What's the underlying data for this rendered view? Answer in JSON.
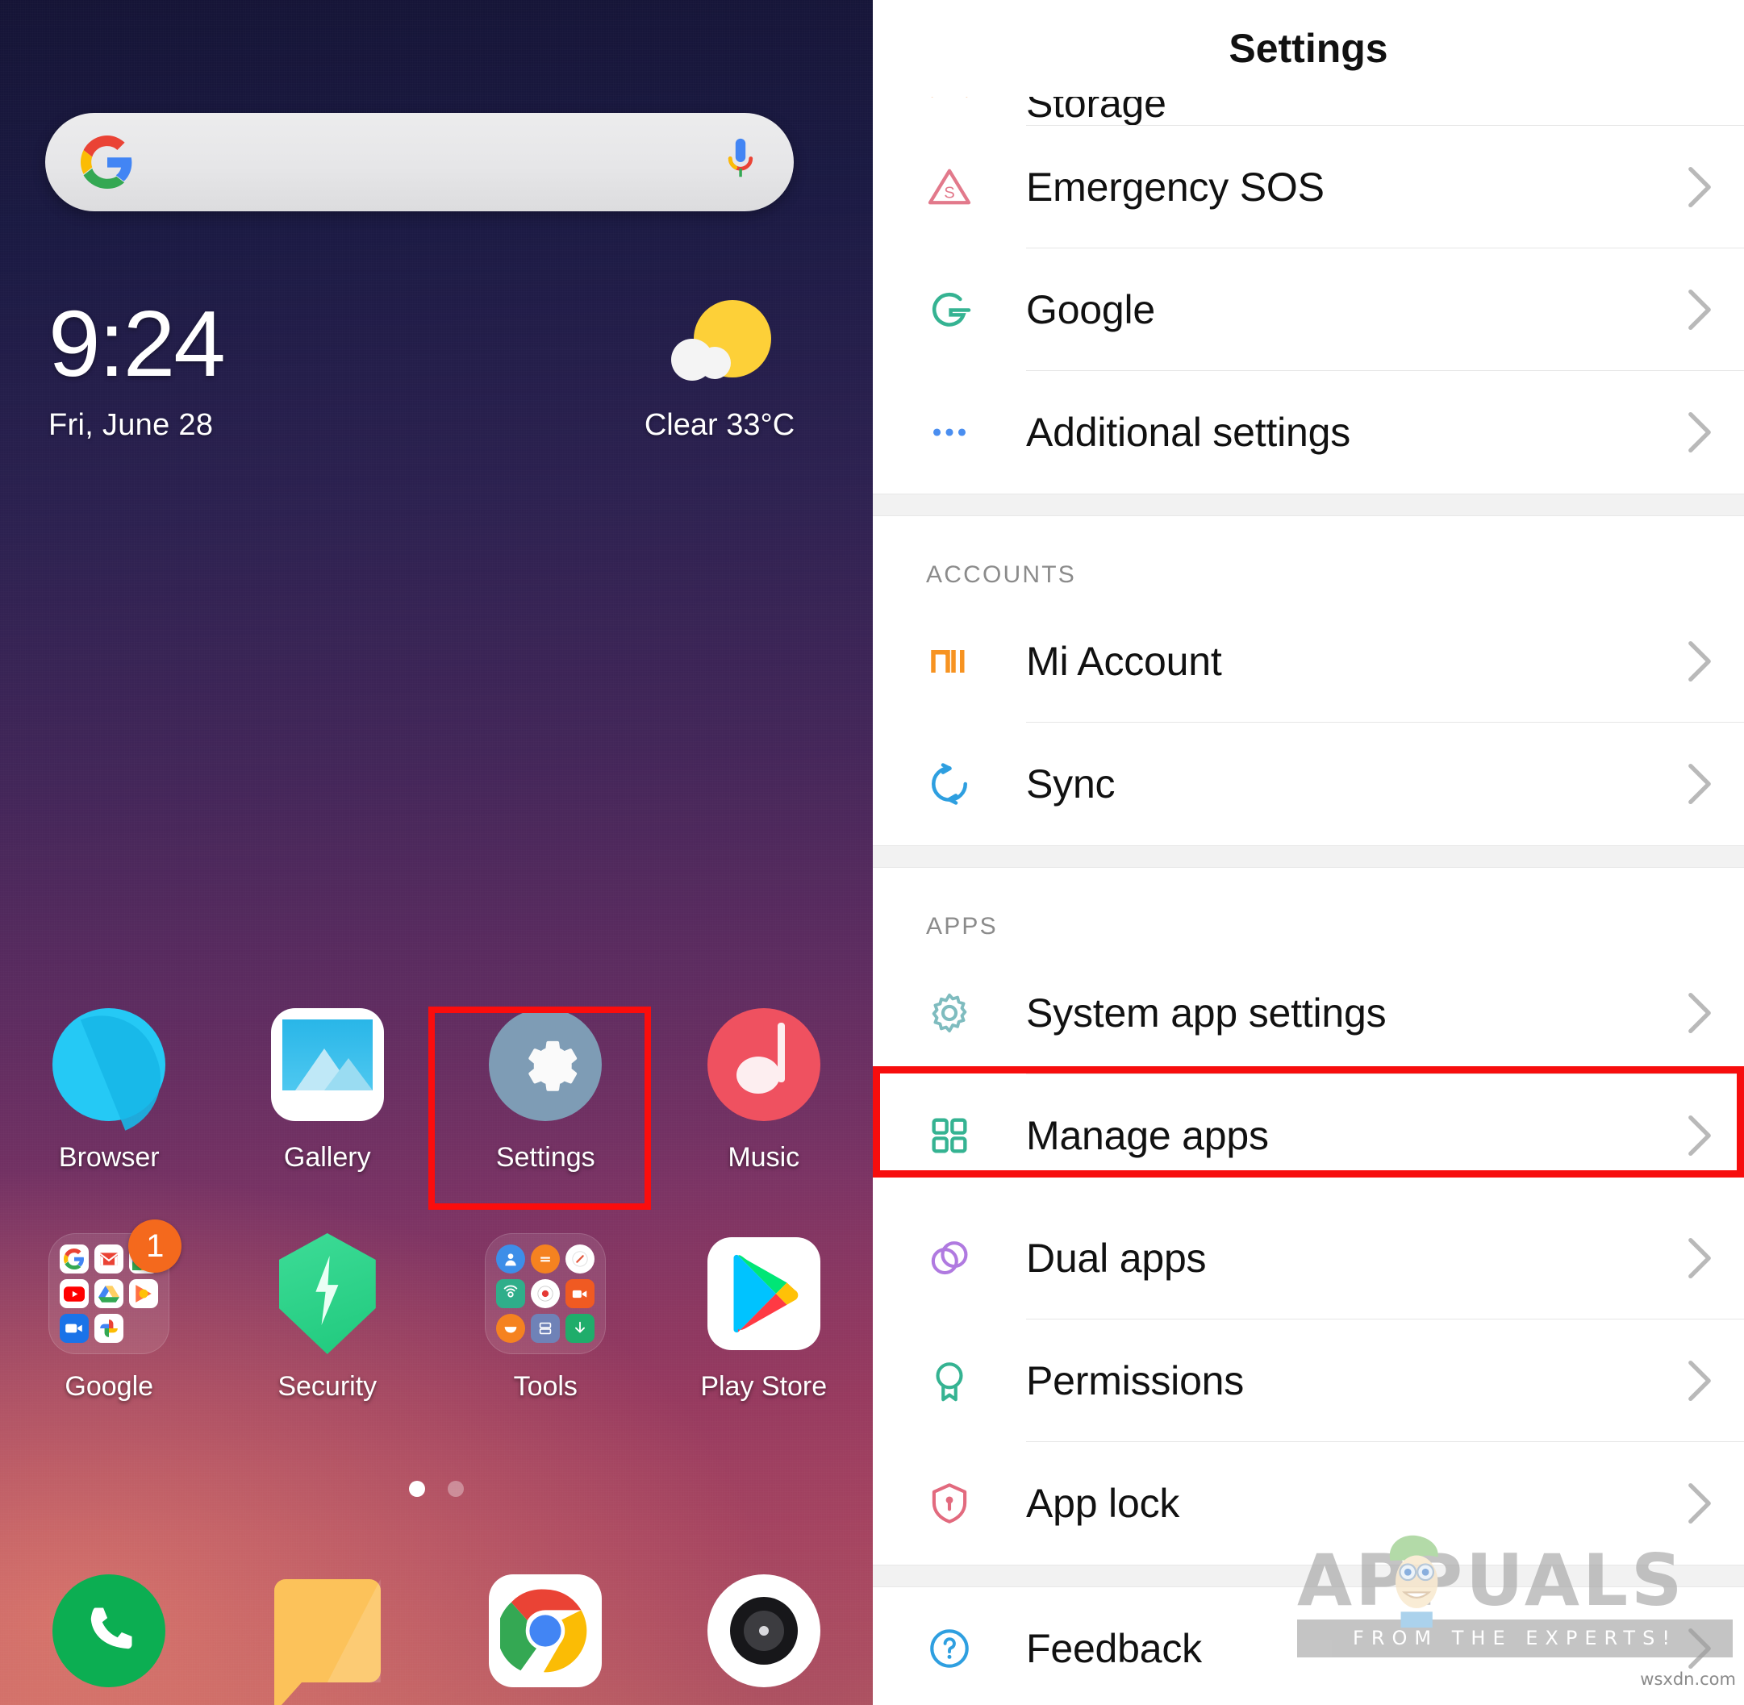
{
  "home": {
    "search": {
      "placeholder": "",
      "google_icon": "google-g-logo",
      "mic_icon": "microphone-icon"
    },
    "clock": {
      "time": "9:24",
      "date": "Fri, June 28"
    },
    "weather": {
      "condition": "Clear",
      "temperature": "33°C",
      "summary": "Clear  33°C",
      "icon": "sun-behind-cloud-icon"
    },
    "apps_row1": [
      {
        "label": "Browser",
        "icon": "browser-icon",
        "highlighted": false
      },
      {
        "label": "Gallery",
        "icon": "gallery-icon",
        "highlighted": false
      },
      {
        "label": "Settings",
        "icon": "settings-gear-icon",
        "highlighted": true
      },
      {
        "label": "Music",
        "icon": "music-note-icon",
        "highlighted": false
      }
    ],
    "apps_row2": [
      {
        "label": "Google",
        "icon": "google-folder-icon",
        "badge": "1"
      },
      {
        "label": "Security",
        "icon": "security-shield-icon",
        "badge": ""
      },
      {
        "label": "Tools",
        "icon": "tools-folder-icon",
        "badge": ""
      },
      {
        "label": "Play Store",
        "icon": "play-store-icon",
        "badge": ""
      }
    ],
    "page_dots": {
      "count": 2,
      "active_index": 0
    },
    "dock": [
      {
        "name": "phone-icon"
      },
      {
        "name": "messages-icon"
      },
      {
        "name": "chrome-icon"
      },
      {
        "name": "camera-icon"
      }
    ]
  },
  "settings": {
    "title": "Settings",
    "clipped_top_item": {
      "label": "Storage",
      "icon": "storage-icon"
    },
    "groups": [
      {
        "header": "",
        "items": [
          {
            "label": "Emergency SOS",
            "icon": "emergency-sos-icon",
            "icon_color": "#e2798b",
            "highlighted": false
          },
          {
            "label": "Google",
            "icon": "google-g-outline-icon",
            "icon_color": "#35b392",
            "highlighted": false
          },
          {
            "label": "Additional settings",
            "icon": "more-dots-icon",
            "icon_color": "#4a8ef0",
            "highlighted": false
          }
        ]
      },
      {
        "header": "ACCOUNTS",
        "items": [
          {
            "label": "Mi Account",
            "icon": "mi-logo-icon",
            "icon_color": "#f79321",
            "highlighted": false
          },
          {
            "label": "Sync",
            "icon": "sync-icon",
            "icon_color": "#2e9fe0",
            "highlighted": false
          }
        ]
      },
      {
        "header": "APPS",
        "items": [
          {
            "label": "System app settings",
            "icon": "gear-icon",
            "icon_color": "#7fbcbf",
            "highlighted": false
          },
          {
            "label": "Manage apps",
            "icon": "grid-squares-icon",
            "icon_color": "#35b392",
            "highlighted": true
          },
          {
            "label": "Dual apps",
            "icon": "dual-circles-icon",
            "icon_color": "#b07ae0",
            "highlighted": false
          },
          {
            "label": "Permissions",
            "icon": "ribbon-badge-icon",
            "icon_color": "#35b392",
            "highlighted": false
          },
          {
            "label": "App lock",
            "icon": "app-lock-shield-icon",
            "icon_color": "#e26a7e",
            "highlighted": false
          }
        ]
      },
      {
        "header": "",
        "items": [
          {
            "label": "Feedback",
            "icon": "question-mark-icon",
            "icon_color": "#2e9fe0",
            "highlighted": false
          }
        ]
      }
    ],
    "chevron_icon": "chevron-right-icon"
  },
  "watermark": {
    "word": "APPUALS",
    "tagline": "FROM THE EXPERTS!",
    "source": "wsxdn.com"
  },
  "colors": {
    "highlight_red": "#f70d0d",
    "accent_orange": "#f4691d",
    "wallpaper_top": "#151436",
    "wallpaper_bottom": "#c66a63"
  }
}
